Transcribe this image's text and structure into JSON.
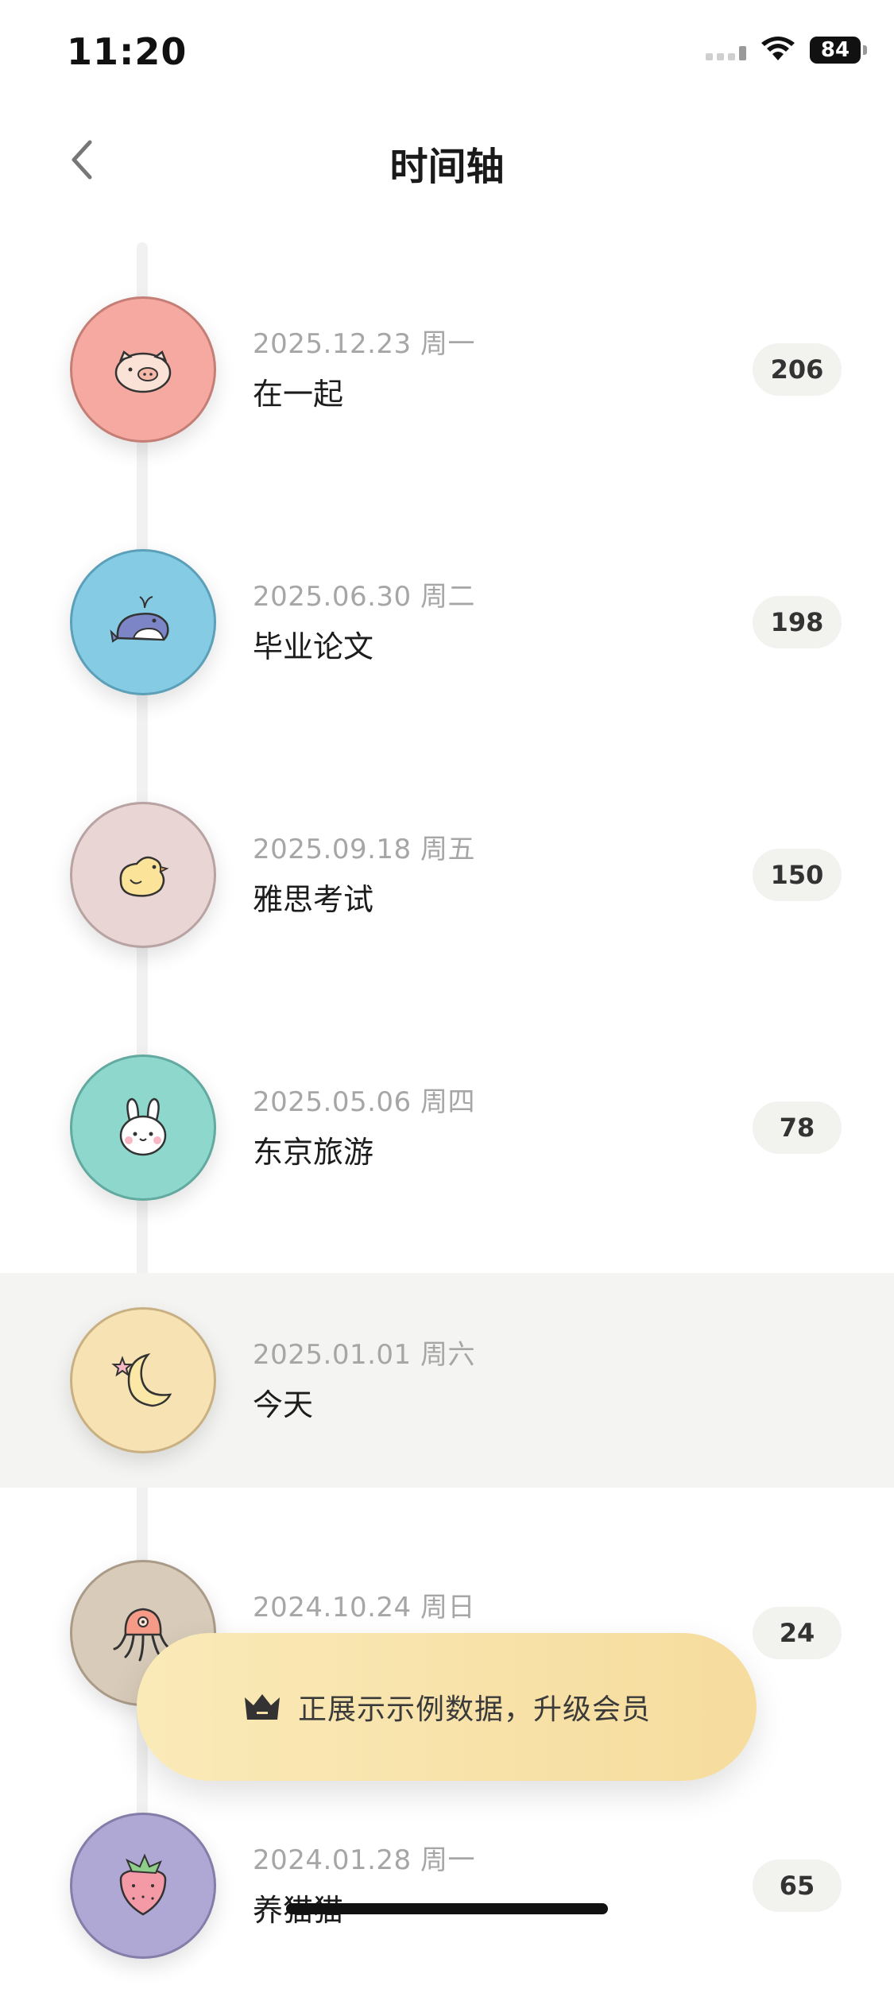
{
  "status_bar": {
    "time": "11:20",
    "battery": "84"
  },
  "header": {
    "title": "时间轴"
  },
  "icons": {
    "back": "chevron-left-icon"
  },
  "events": [
    {
      "date": "2025.12.23 周一",
      "title": "在一起",
      "days": "206",
      "icon": "pig-icon",
      "color": "#f5a9a0",
      "border": "#c47e76"
    },
    {
      "date": "2025.06.30 周二",
      "title": "毕业论文",
      "days": "198",
      "icon": "whale-icon",
      "color": "#86cbe4",
      "border": "#5c9fb8"
    },
    {
      "date": "2025.09.18 周五",
      "title": "雅思考试",
      "days": "150",
      "icon": "chick-icon",
      "color": "#e8d5d4",
      "border": "#b8a3a2"
    },
    {
      "date": "2025.05.06 周四",
      "title": "东京旅游",
      "days": "78",
      "icon": "rabbit-icon",
      "color": "#8ed7cd",
      "border": "#62a99f"
    },
    {
      "date": "2025.01.01 周六",
      "title": "今天",
      "days": "",
      "icon": "moon-icon",
      "color": "#f6e2b3",
      "border": "#c9b083"
    },
    {
      "date": "2024.10.24 周日",
      "title": "",
      "days": "24",
      "icon": "octopus-icon",
      "color": "#d8cbb9",
      "border": "#a99b88"
    },
    {
      "date": "2024.01.28 周一",
      "title": "养猫猫",
      "days": "65",
      "icon": "strawberry-icon",
      "color": "#b0a8d4",
      "border": "#857ca8"
    }
  ],
  "toast": {
    "text": "正展示示例数据，升级会员",
    "icon": "crown-icon"
  }
}
